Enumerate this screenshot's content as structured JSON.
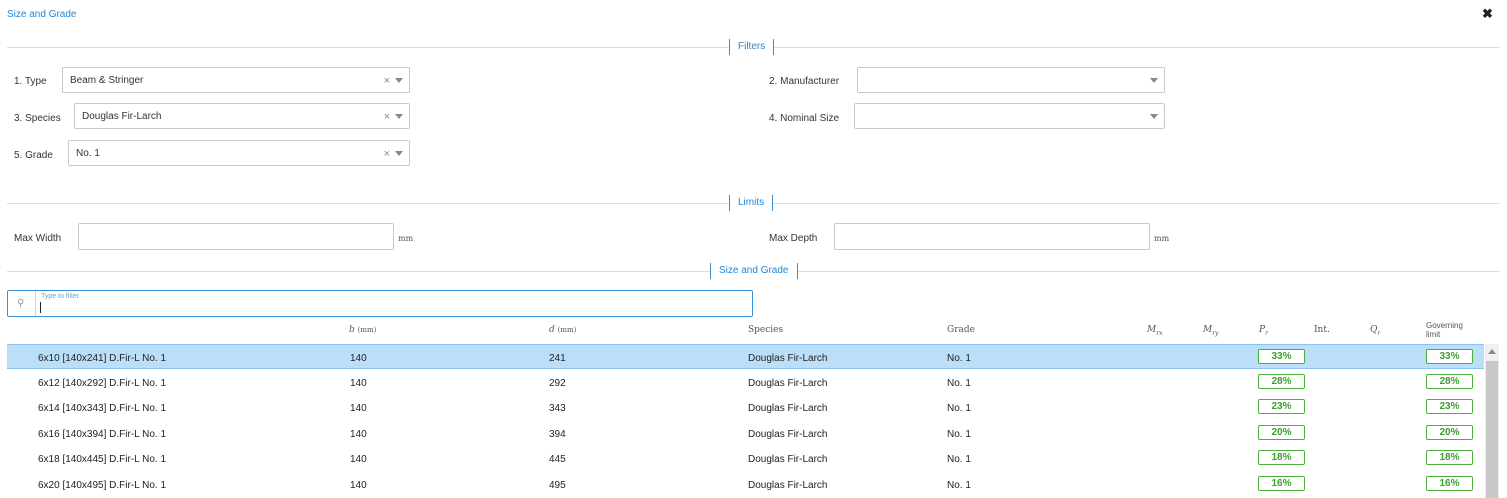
{
  "dialog": {
    "title": "Size and Grade",
    "close_label": "✖"
  },
  "sections": {
    "filters": "Filters",
    "limits": "Limits",
    "size_grade": "Size and Grade"
  },
  "filters": {
    "type": {
      "label": "1. Type",
      "value": "Beam & Stringer"
    },
    "manufacturer": {
      "label": "2. Manufacturer",
      "value": ""
    },
    "species": {
      "label": "3. Species",
      "value": "Douglas Fir-Larch"
    },
    "nominal_size": {
      "label": "4. Nominal Size",
      "value": ""
    },
    "grade": {
      "label": "5. Grade",
      "value": "No. 1"
    },
    "clear_icon": "×"
  },
  "limits": {
    "max_width": {
      "label": "Max Width",
      "value": "",
      "unit": "mm"
    },
    "max_depth": {
      "label": "Max Depth",
      "value": "",
      "unit": "mm"
    }
  },
  "search": {
    "placeholder": "Type to filter",
    "value": "",
    "icon": "search-icon"
  },
  "table": {
    "headers": {
      "b": "b",
      "b_unit": "(mm)",
      "d": "d",
      "d_unit": "(mm)",
      "species": "Species",
      "grade": "Grade",
      "mrx": "Mrx",
      "mry": "Mry",
      "pr": "Pr",
      "int": "Int.",
      "qr": "Qr",
      "governing": "Governing",
      "governing2": "limit"
    },
    "rows": [
      {
        "name": "6x10 [140x241] D.Fir-L No. 1",
        "b": "140",
        "d": "241",
        "species": "Douglas Fir-Larch",
        "grade": "No. 1",
        "pr": "33%",
        "gov": "33%",
        "selected": true
      },
      {
        "name": "6x12 [140x292] D.Fir-L No. 1",
        "b": "140",
        "d": "292",
        "species": "Douglas Fir-Larch",
        "grade": "No. 1",
        "pr": "28%",
        "gov": "28%"
      },
      {
        "name": "6x14 [140x343] D.Fir-L No. 1",
        "b": "140",
        "d": "343",
        "species": "Douglas Fir-Larch",
        "grade": "No. 1",
        "pr": "23%",
        "gov": "23%"
      },
      {
        "name": "6x16 [140x394] D.Fir-L No. 1",
        "b": "140",
        "d": "394",
        "species": "Douglas Fir-Larch",
        "grade": "No. 1",
        "pr": "20%",
        "gov": "20%"
      },
      {
        "name": "6x18 [140x445] D.Fir-L No. 1",
        "b": "140",
        "d": "445",
        "species": "Douglas Fir-Larch",
        "grade": "No. 1",
        "pr": "18%",
        "gov": "18%"
      },
      {
        "name": "6x20 [140x495] D.Fir-L No. 1",
        "b": "140",
        "d": "495",
        "species": "Douglas Fir-Larch",
        "grade": "No. 1",
        "pr": "16%",
        "gov": "16%"
      }
    ]
  },
  "colors": {
    "accent": "#1e88d8",
    "selected_row": "#bcdff9",
    "badge_green": "#3aa02c"
  }
}
